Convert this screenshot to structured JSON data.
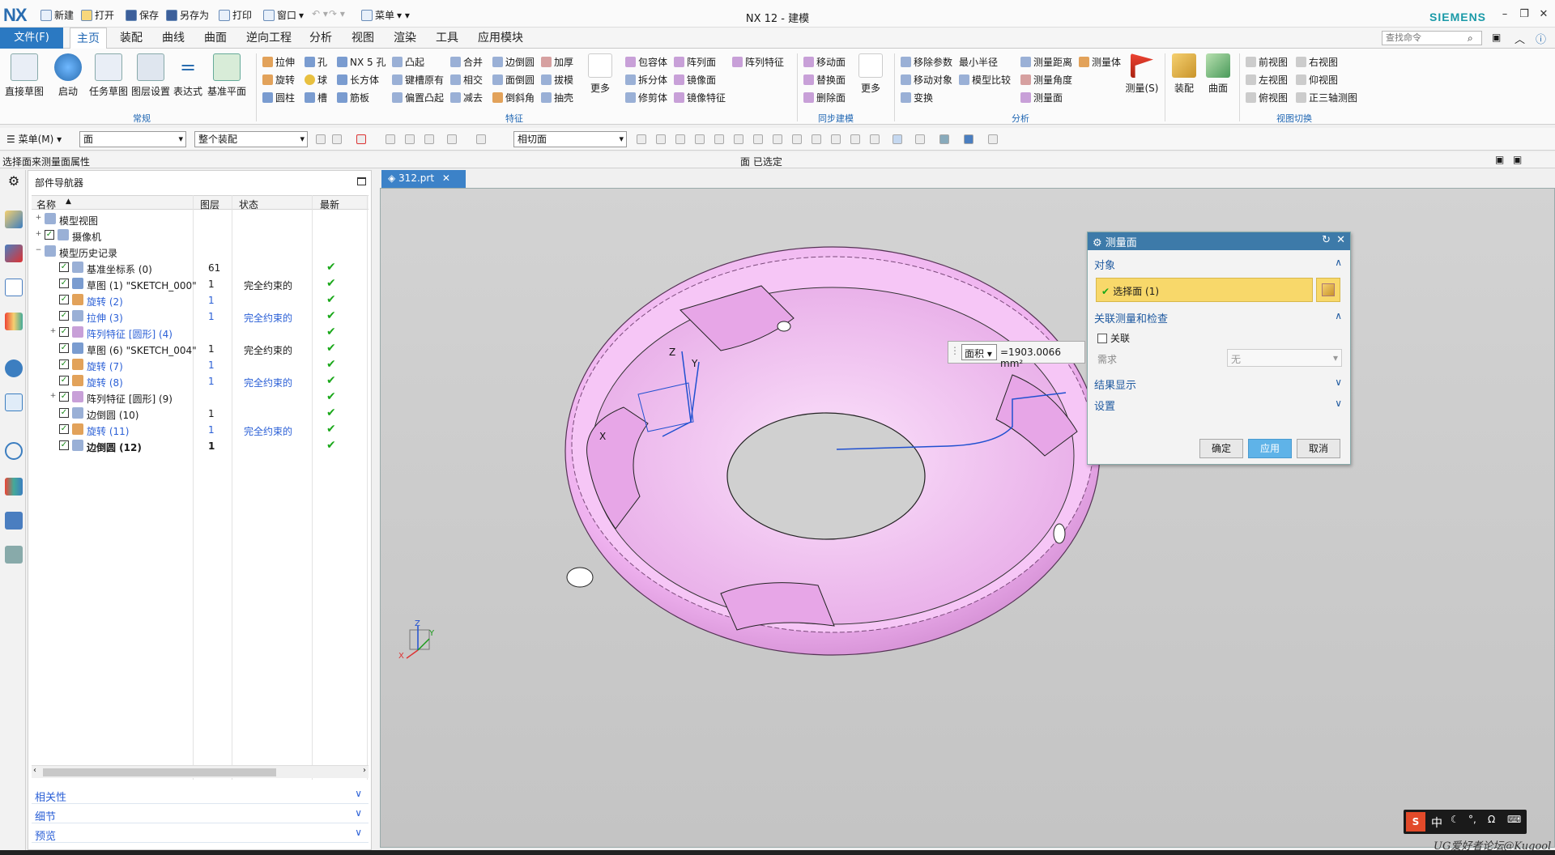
{
  "titlebar": {
    "logo": "NX",
    "quick_new": "新建",
    "quick_open": "打开",
    "quick_save": "保存",
    "quick_saveas": "另存为",
    "quick_print": "打印",
    "quick_window": "窗口",
    "quick_menu": "菜单",
    "title": "NX 12 - 建模",
    "brand": "SIEMENS"
  },
  "ribbon_tabs": {
    "file": "文件(F)",
    "tabs": [
      "主页",
      "装配",
      "曲线",
      "曲面",
      "逆向工程",
      "分析",
      "视图",
      "渲染",
      "工具",
      "应用模块"
    ],
    "search_placeholder": "查找命令"
  },
  "ribbon": {
    "group_regular": {
      "label": "常规",
      "buttons": [
        "直接草图",
        "启动",
        "任务草图",
        "图层设置",
        "表达式",
        "基准平面"
      ]
    },
    "group_feature": {
      "label": "特征",
      "items": [
        "拉伸",
        "孔",
        "NX 5 孔",
        "凸起",
        "合并",
        "边倒圆",
        "加厚",
        "旋转",
        "球",
        "长方体",
        "键槽原有",
        "相交",
        "面倒圆",
        "拔模",
        "圆柱",
        "槽",
        "筋板",
        "偏置凸起",
        "减去",
        "倒斜角",
        "抽壳",
        "更多",
        "包容体",
        "阵列面",
        "阵列特征",
        "拆分体",
        "镜像面",
        "修剪体",
        "镜像特征"
      ]
    },
    "group_sync": {
      "label": "同步建模",
      "items": [
        "移动面",
        "替换面",
        "删除面",
        "更多"
      ]
    },
    "group_analysis": {
      "label": "分析",
      "items": [
        "移除参数",
        "最小半径",
        "测量距离",
        "测量体",
        "移动对象",
        "模型比较",
        "测量角度",
        "变换",
        "测量面",
        "测量(S)"
      ]
    },
    "group_assembly": {
      "items": [
        "装配",
        "曲面"
      ]
    },
    "group_views": {
      "label": "视图切换",
      "items": [
        "前视图",
        "右视图",
        "左视图",
        "仰视图",
        "俯视图",
        "正三轴测图"
      ]
    }
  },
  "toolbar2": {
    "menu_label": "菜单(M)",
    "filter_type": "面",
    "filter_scope": "整个装配",
    "face_rule": "相切面"
  },
  "status": {
    "left": "选择面来测量面属性",
    "center": "面 已选定"
  },
  "navigator": {
    "title": "部件导航器",
    "columns": [
      "名称",
      "图层",
      "状态",
      "最新"
    ],
    "rows": [
      {
        "name": "模型视图",
        "layer": "",
        "status": "",
        "latest": "",
        "level": 0,
        "expand": "+",
        "check": false,
        "style": ""
      },
      {
        "name": "摄像机",
        "layer": "",
        "status": "",
        "latest": "",
        "level": 0,
        "expand": "+",
        "check": true,
        "style": ""
      },
      {
        "name": "模型历史记录",
        "layer": "",
        "status": "",
        "latest": "",
        "level": 0,
        "expand": "−",
        "check": false,
        "style": ""
      },
      {
        "name": "基准坐标系 (0)",
        "layer": "61",
        "status": "",
        "latest": "✔",
        "level": 1,
        "expand": "",
        "check": true,
        "style": ""
      },
      {
        "name": "草图 (1) \"SKETCH_000\"",
        "layer": "1",
        "status": "完全约束的",
        "latest": "✔",
        "level": 1,
        "expand": "",
        "check": true,
        "style": ""
      },
      {
        "name": "旋转 (2)",
        "layer": "1",
        "status": "",
        "latest": "✔",
        "level": 1,
        "expand": "",
        "check": true,
        "style": "blue"
      },
      {
        "name": "拉伸 (3)",
        "layer": "1",
        "status": "完全约束的",
        "latest": "✔",
        "level": 1,
        "expand": "",
        "check": true,
        "style": "blue"
      },
      {
        "name": "阵列特征 [圆形] (4)",
        "layer": "",
        "status": "",
        "latest": "✔",
        "level": 1,
        "expand": "+",
        "check": true,
        "style": "blue"
      },
      {
        "name": "草图 (6) \"SKETCH_004\"",
        "layer": "1",
        "status": "完全约束的",
        "latest": "✔",
        "level": 1,
        "expand": "",
        "check": true,
        "style": ""
      },
      {
        "name": "旋转 (7)",
        "layer": "1",
        "status": "",
        "latest": "✔",
        "level": 1,
        "expand": "",
        "check": true,
        "style": "blue"
      },
      {
        "name": "旋转 (8)",
        "layer": "1",
        "status": "完全约束的",
        "latest": "✔",
        "level": 1,
        "expand": "",
        "check": true,
        "style": "blue"
      },
      {
        "name": "阵列特征 [圆形] (9)",
        "layer": "",
        "status": "",
        "latest": "✔",
        "level": 1,
        "expand": "+",
        "check": true,
        "style": ""
      },
      {
        "name": "边倒圆 (10)",
        "layer": "1",
        "status": "",
        "latest": "✔",
        "level": 1,
        "expand": "",
        "check": true,
        "style": ""
      },
      {
        "name": "旋转 (11)",
        "layer": "1",
        "status": "完全约束的",
        "latest": "✔",
        "level": 1,
        "expand": "",
        "check": true,
        "style": "blue"
      },
      {
        "name": "边倒圆 (12)",
        "layer": "1",
        "status": "",
        "latest": "✔",
        "level": 1,
        "expand": "",
        "check": true,
        "style": "bold"
      }
    ],
    "accordions": [
      "相关性",
      "细节",
      "预览"
    ]
  },
  "graphics": {
    "tab": "312.prt",
    "axis_labels": {
      "x": "X",
      "y": "Y",
      "z": "Z"
    }
  },
  "measure_readout": {
    "type": "面积",
    "value": "=1903.0066 mm²"
  },
  "dialog": {
    "title": "测量面",
    "sec_object": "对象",
    "select_face": "选择面 (1)",
    "sec_assoc": "关联测量和检查",
    "assoc_label": "关联",
    "req_label": "需求",
    "req_value": "无",
    "sec_result": "结果显示",
    "sec_settings": "设置",
    "btn_ok": "确定",
    "btn_apply": "应用",
    "btn_cancel": "取消"
  },
  "ime": {
    "label": "中"
  },
  "watermark": "UG爱好者论坛@Kugool",
  "colors": {
    "accent": "#2b79c2",
    "part": "#f2b6f2",
    "dialog_title": "#3d7aa9",
    "selection": "#f8d86a",
    "ok_green": "#1aa81a"
  }
}
